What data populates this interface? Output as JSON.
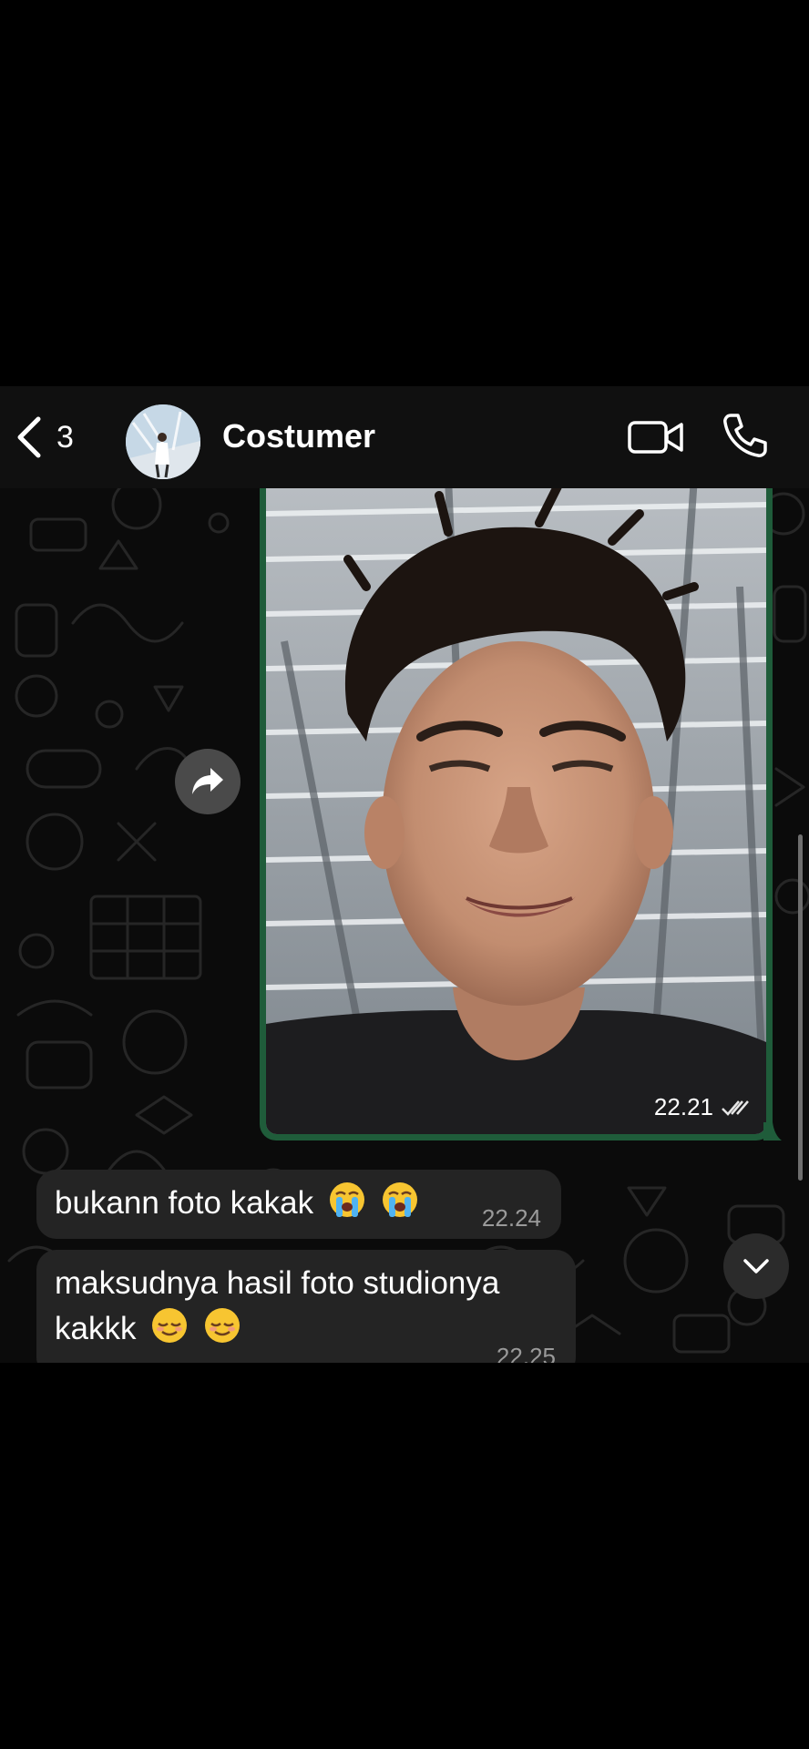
{
  "header": {
    "back_count": "3",
    "contact_name": "Costumer",
    "back_icon": "chevron-left-icon",
    "video_icon": "video-camera-icon",
    "call_icon": "phone-icon"
  },
  "messages": {
    "image": {
      "time": "22.21",
      "status_icon": "double-check-icon",
      "bubble_color": "#1f5c3a"
    },
    "text": [
      {
        "text": "bukann foto kakak",
        "emoji": [
          "loudly-crying-face",
          "loudly-crying-face"
        ],
        "time": "22.24"
      },
      {
        "line1": "maksudnya hasil foto studionya",
        "line2": "kakkk",
        "emoji": [
          "relieved-face",
          "relieved-face"
        ],
        "time": "22.25"
      }
    ]
  },
  "controls": {
    "forward_icon": "forward-arrow-icon",
    "scroll_down_icon": "chevron-down-icon"
  },
  "colors": {
    "background": "#000000",
    "header": "#101010",
    "incoming_bubble": "#242424",
    "timestamp": "#9a9a9a"
  }
}
